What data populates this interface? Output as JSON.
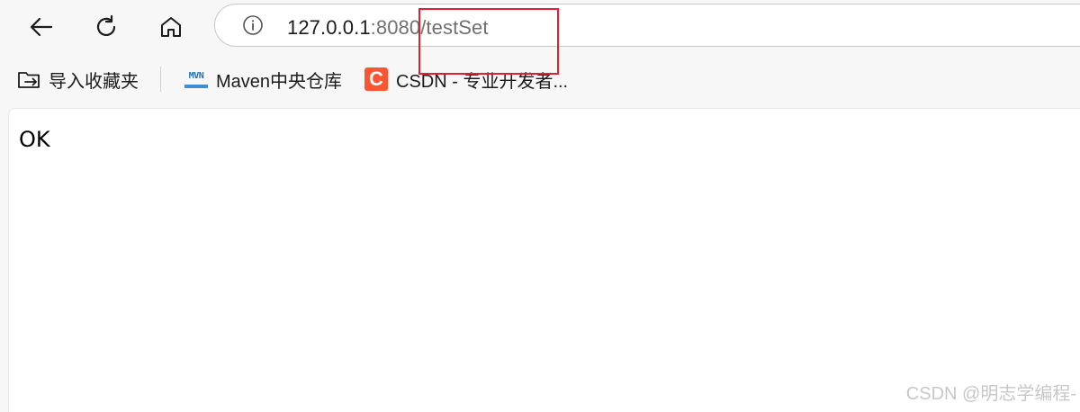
{
  "toolbar": {
    "back_icon": "arrow-left-icon",
    "refresh_icon": "refresh-icon",
    "home_icon": "home-icon"
  },
  "address_bar": {
    "info_icon": "info-icon",
    "url_host": "127.0.0.1",
    "url_rest": ":8080/testSet"
  },
  "bookmarks": [
    {
      "label": "导入收藏夹",
      "icon": "import-folder-icon"
    },
    {
      "label": "Maven中央仓库",
      "icon": "maven-icon",
      "icon_text": "MVN"
    },
    {
      "label": "CSDN - 专业开发者...",
      "icon": "csdn-icon",
      "icon_text": "C"
    }
  ],
  "page": {
    "body_text": "OK"
  },
  "watermark": "CSDN @明志学编程-",
  "colors": {
    "highlight": "#d9232e",
    "csdn_brand": "#fc5531",
    "maven_blue": "#1f6fb5"
  }
}
